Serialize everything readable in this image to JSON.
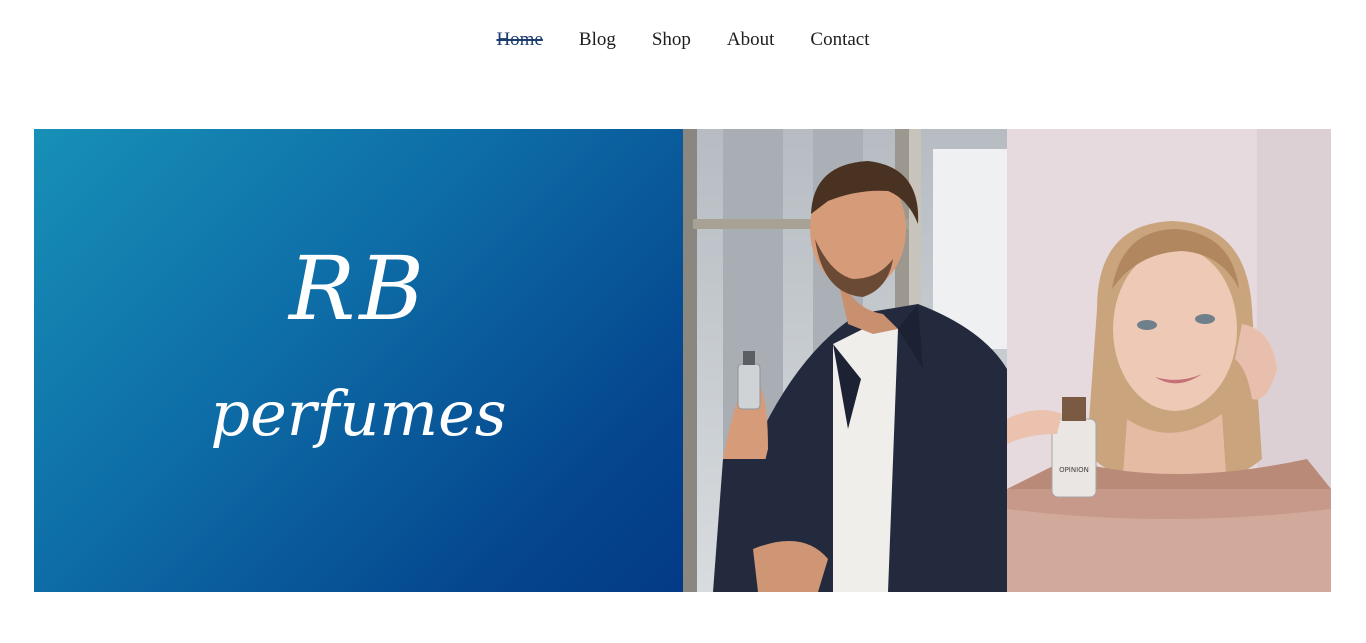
{
  "nav": {
    "items": [
      {
        "label": "Home",
        "active": true
      },
      {
        "label": "Blog",
        "active": false
      },
      {
        "label": "Shop",
        "active": false
      },
      {
        "label": "About",
        "active": false
      },
      {
        "label": "Contact",
        "active": false
      }
    ]
  },
  "hero": {
    "brand_line1": "RB",
    "brand_line2": "perfumes",
    "bottle_label": "OPINION"
  },
  "colors": {
    "nav_active": "#1c3d6e",
    "brand_gradient_start": "#1790b7",
    "brand_gradient_end": "#043a86"
  }
}
